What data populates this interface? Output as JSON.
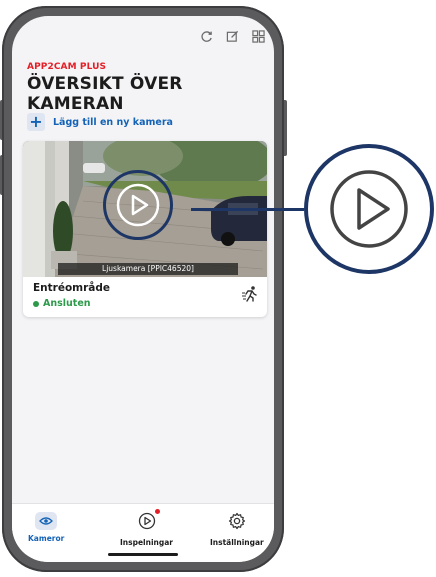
{
  "app": {
    "brand": "APP2CAM PLUS",
    "page_title": "ÖVERSIKT ÖVER KAMERAN",
    "add_camera_label": "Lägg till en ny kamera"
  },
  "top_icons": [
    "refresh-icon",
    "edit-icon",
    "grid-icon"
  ],
  "camera": {
    "caption": "Ljuskamera [PPIC46520]",
    "name": "Entréområde",
    "status": "Ansluten",
    "status_color": "#2c9a4a"
  },
  "tabs": [
    {
      "label": "Kameror",
      "icon": "camera-eye-icon",
      "active": true
    },
    {
      "label": "Inspelningar",
      "icon": "play-circle-icon",
      "active": false,
      "notification": true
    },
    {
      "label": "Inställningar",
      "icon": "gear-icon",
      "active": false
    }
  ],
  "colors": {
    "accent": "#1463b6",
    "brand_red": "#e41e26",
    "callout": "#1d3666"
  }
}
